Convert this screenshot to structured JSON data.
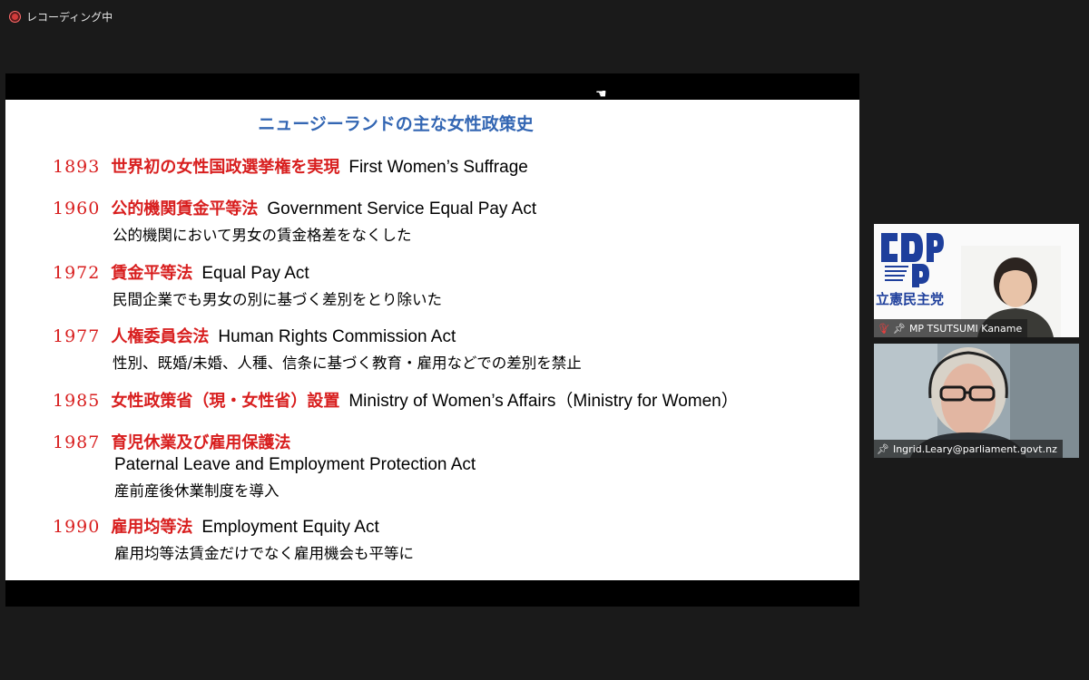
{
  "recording": {
    "label": "レコーディング中"
  },
  "slide": {
    "title": "ニュージーランドの主な女性政策史",
    "entries": [
      {
        "year": "1893",
        "jp": "世界初の女性国政選挙権を実現",
        "en": "First Women’s Suffrage"
      },
      {
        "year": "1960",
        "jp": "公的機関賃金平等法",
        "en": "Government Service Equal Pay Act",
        "sub": "公的機関において男女の賃金格差をなくした"
      },
      {
        "year": "1972",
        "jp": "賃金平等法",
        "en": "Equal Pay Act",
        "sub": "民間企業でも男女の別に基づく差別をとり除いた"
      },
      {
        "year": "1977",
        "jp": "人権委員会法",
        "en": "Human Rights Commission Act",
        "sub": "性別、既婚/未婚、人種、信条に基づく教育・雇用などでの差別を禁止"
      },
      {
        "year": "1985",
        "jp": "女性政策省（現・女性省）設置",
        "en": "Ministry of Women’s Affairs（Ministry for Women）"
      },
      {
        "year": "1987",
        "jp": "育児休業及び雇用保護法",
        "en_line": "Paternal Leave and Employment Protection Act",
        "sub": "産前産後休業制度を導入"
      },
      {
        "year": "1990",
        "jp": "雇用均等法",
        "en": "Employment Equity Act",
        "sub": "雇用均等法賃金だけでなく雇用機会も平等に"
      }
    ]
  },
  "participants": [
    {
      "name": "MP TSUTSUMI Kaname",
      "party_name": "立憲民主党",
      "logo_text": "CDP",
      "muted": true
    },
    {
      "name": "Ingrid.Leary@parliament.govt.nz",
      "muted": false
    }
  ],
  "colors": {
    "slide_title": "#3366b3",
    "accent_red": "#d81e1e",
    "party_blue": "#1e3f9c"
  }
}
